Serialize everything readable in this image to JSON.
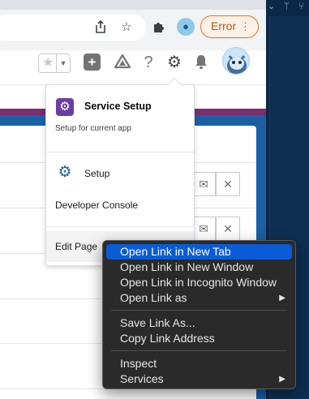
{
  "browser": {
    "error_label": "Error",
    "error_menu_glyph": "⋮",
    "toolbar_icons": [
      "share-icon",
      "bookmark-star-icon",
      "extensions-puzzle-icon",
      "profile-icon"
    ]
  },
  "header": {
    "icons": [
      "favorites-star-icon",
      "favorites-dropdown-icon",
      "global-create-icon",
      "trailhead-icon",
      "help-icon",
      "setup-gear-icon",
      "notifications-bell-icon",
      "user-avatar"
    ]
  },
  "setup_menu": {
    "service_setup_title": "Service Setup",
    "service_setup_subtitle": "Setup for current app",
    "setup_label": "Setup",
    "developer_console_label": "Developer Console",
    "edit_page_label": "Edit Page"
  },
  "context_menu": {
    "items": [
      {
        "label": "Open Link in New Tab",
        "highlighted": true
      },
      {
        "label": "Open Link in New Window"
      },
      {
        "label": "Open Link in Incognito Window"
      },
      {
        "label": "Open Link as",
        "submenu": true
      },
      {
        "label": "Save Link As..."
      },
      {
        "label": "Copy Link Address"
      },
      {
        "label": "Inspect"
      },
      {
        "label": "Services",
        "submenu": true
      }
    ],
    "highlight_color": "#0a5bd8"
  },
  "colors": {
    "error_accent": "#e3731f",
    "brand_purple": "#7b2d6f",
    "page_blue": "#1b5fa6"
  }
}
